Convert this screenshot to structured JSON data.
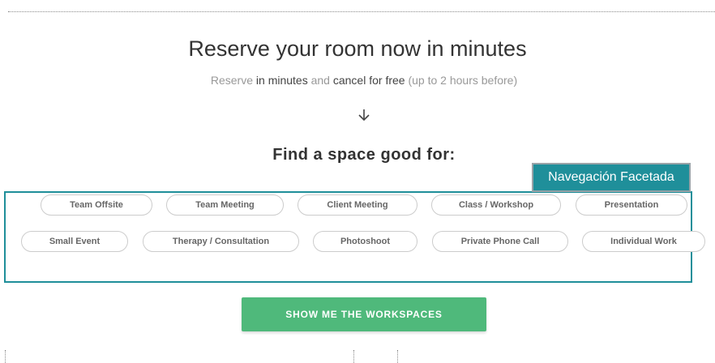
{
  "hero": {
    "title": "Reserve your room now in minutes",
    "subtitle_parts": [
      "Reserve",
      "in minutes",
      "and",
      "cancel for free",
      "(up to 2 hours before)"
    ]
  },
  "arrow_icon": "arrow-down-icon",
  "filters": {
    "heading": "Find a space good for:",
    "tag_label": "Navegación Facetada",
    "options_row1": [
      "Team Offsite",
      "Team Meeting",
      "Client Meeting",
      "Class / Workshop",
      "Presentation"
    ],
    "options_row2": [
      "Small Event",
      "Therapy / Consultation",
      "Photoshoot",
      "Private Phone Call",
      "Individual Work"
    ]
  },
  "cta": {
    "label": "SHOW ME THE WORKSPACES"
  },
  "colors": {
    "accent_teal": "#1f8f9a",
    "cta_green": "#4fb97b"
  }
}
